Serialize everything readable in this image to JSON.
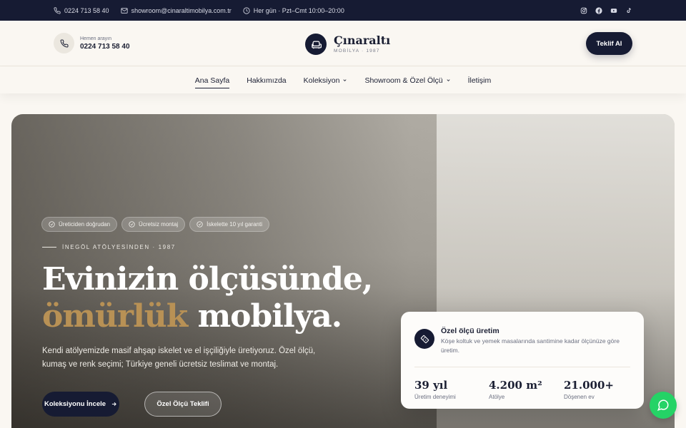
{
  "topbar": {
    "phone": "0224 713 58 40",
    "email": "showroom@cinaraltimobilya.com.tr",
    "hours": "Her gün · Pzt–Cmt 10:00–20:00",
    "socials": [
      "instagram-icon",
      "facebook-icon",
      "youtube-icon",
      "tiktok-icon"
    ]
  },
  "header": {
    "call_label": "Hemen arayın",
    "call_number": "0224 713 58 40",
    "brand_name": "Çınaraltı",
    "brand_sub": "MOBİLYA · 1987",
    "quote_button": "Teklif Al"
  },
  "nav": {
    "items": [
      {
        "label": "Ana Sayfa",
        "active": true
      },
      {
        "label": "Hakkımızda"
      },
      {
        "label": "Koleksiyon",
        "dropdown": true
      },
      {
        "label": "Showroom & Özel Ölçü",
        "dropdown": true
      },
      {
        "label": "İletişim"
      }
    ]
  },
  "hero": {
    "badges": [
      "Üreticiden doğrudan",
      "Ücretsiz montaj",
      "İskelette 10 yıl garanti"
    ],
    "eyebrow": "İNEGÖL ATÖLYESİNDEN · 1987",
    "headline_line1": "Evinizin ölçüsünde,",
    "headline_accent": "ömürlük",
    "headline_rest": " mobilya.",
    "lead": "Kendi atölyemizde masif ahşap iskelet ve el işçiliğiyle üretiyoruz. Özel ölçü, kumaş ve renk seçimi; Türkiye geneli ücretsiz teslimat ve montaj.",
    "cta_primary": "Koleksiyonu İncele",
    "cta_secondary": "Özel Ölçü Teklifi"
  },
  "card": {
    "title": "Özel ölçü üretim",
    "desc": "Köşe koltuk ve yemek masalarında santimine kadar ölçünüze göre üretim.",
    "stats": [
      {
        "num": "39 yıl",
        "label": "Üretim deneyimi"
      },
      {
        "num": "4.200 m²",
        "label": "Atölye"
      },
      {
        "num": "21.000+",
        "label": "Döşenen ev"
      }
    ]
  },
  "colors": {
    "navy": "#161b33",
    "accent": "#b89155",
    "cream": "#faf7f2",
    "whatsapp": "#25d366"
  }
}
